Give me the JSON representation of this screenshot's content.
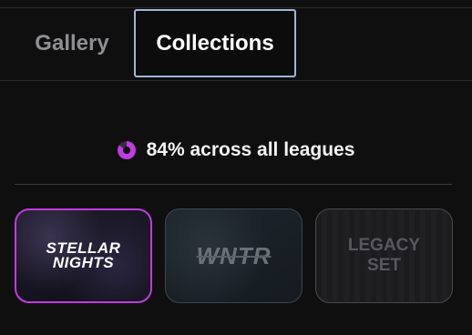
{
  "tabs": [
    {
      "label": "Gallery",
      "selected": false
    },
    {
      "label": "Collections",
      "selected": true
    }
  ],
  "progress": {
    "percent": 84,
    "text": "84% across all leagues",
    "ring_color": "#c03be0",
    "ring_track_color": "#3a2a44"
  },
  "collections": [
    {
      "name": "STELLAR\nNIGHTS",
      "selected": true,
      "accent": "#c03be0"
    },
    {
      "name": "WNTR",
      "selected": false
    },
    {
      "name": "LEGACY\nSET",
      "selected": false
    }
  ]
}
